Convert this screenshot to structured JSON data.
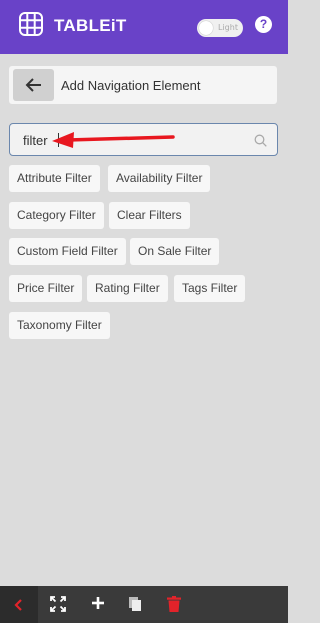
{
  "header": {
    "brand": "TABLEiT",
    "theme_toggle_label": "Light",
    "help_symbol": "?",
    "logo_icon": "grid-table-icon",
    "background_color": "#6942c8"
  },
  "panel": {
    "title": "Add Navigation Element",
    "back_icon": "arrow-left-icon"
  },
  "search": {
    "value": "filter",
    "icon": "search-icon",
    "annotation_icon": "red-arrow-pointer",
    "annotation_color": "#e8171f"
  },
  "results": [
    {
      "label": "Attribute Filter"
    },
    {
      "label": "Availability Filter"
    },
    {
      "label": "Category Filter"
    },
    {
      "label": "Clear Filters"
    },
    {
      "label": "Custom Field Filter"
    },
    {
      "label": "On Sale Filter"
    },
    {
      "label": "Price Filter"
    },
    {
      "label": "Rating Filter"
    },
    {
      "label": "Tags Filter"
    },
    {
      "label": "Taxonomy Filter"
    }
  ],
  "footer": {
    "icons": [
      "chevron-left-icon",
      "expand-icon",
      "plus-icon",
      "copy-icon",
      "trash-icon"
    ],
    "accent_color": "#e2232a"
  }
}
